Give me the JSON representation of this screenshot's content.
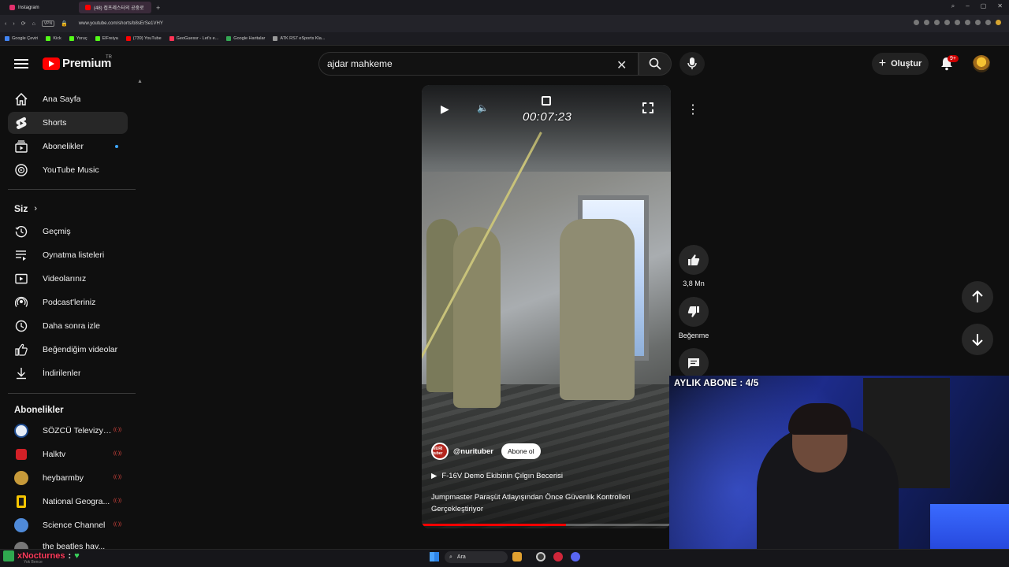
{
  "browser": {
    "tabs": [
      {
        "label": "Instagram",
        "color": "#e1306c",
        "active": false
      },
      {
        "label": "(48) 접프레스터의 공중로",
        "color": "#ff0000",
        "active": true
      }
    ],
    "url": "www.youtube.com/shorts/b8sErSe1VHY",
    "vpn_label": "VPN",
    "bookmarks": [
      {
        "label": "Google Çeviri",
        "color": "#4285f4"
      },
      {
        "label": "Kick",
        "color": "#53fc18"
      },
      {
        "label": "Yoruç",
        "color": "#53fc18"
      },
      {
        "label": "ElFreiya",
        "color": "#53fc18"
      },
      {
        "label": "(739) YouTube",
        "color": "#ff0000"
      },
      {
        "label": "GeoGuessr - Let's e...",
        "color": "#ff3355"
      },
      {
        "label": "Google Haritalar",
        "color": "#34a853"
      },
      {
        "label": "ATK RS7 eSports Kla...",
        "color": "#999999"
      }
    ]
  },
  "header": {
    "logo_text": "Premium",
    "country_code": "TR",
    "search_value": "ajdar mahkeme",
    "create_label": "Oluştur",
    "notification_count": "9+"
  },
  "sidebar": {
    "primary": [
      {
        "label": "Ana Sayfa",
        "icon": "home-icon"
      },
      {
        "label": "Shorts",
        "icon": "shorts-icon",
        "active": true
      },
      {
        "label": "Abonelikler",
        "icon": "subscriptions-icon",
        "dot": true
      },
      {
        "label": "YouTube Music",
        "icon": "music-icon"
      }
    ],
    "you_heading": "Siz",
    "you_items": [
      {
        "label": "Geçmiş",
        "icon": "history-icon"
      },
      {
        "label": "Oynatma listeleri",
        "icon": "playlists-icon"
      },
      {
        "label": "Videolarınız",
        "icon": "your-videos-icon"
      },
      {
        "label": "Podcast'leriniz",
        "icon": "podcasts-icon"
      },
      {
        "label": "Daha sonra izle",
        "icon": "watch-later-icon"
      },
      {
        "label": "Beğendiğim videolar",
        "icon": "liked-icon"
      },
      {
        "label": "İndirilenler",
        "icon": "downloads-icon"
      }
    ],
    "subs_heading": "Abonelikler",
    "subscriptions": [
      {
        "label": "SÖZCÜ Televizyo...",
        "color": "#e8eef7",
        "live": "((·))"
      },
      {
        "label": "Halktv",
        "color": "#d32027",
        "live": "((·))"
      },
      {
        "label": "heybarmby",
        "color": "#c79a3a",
        "live": "((·))"
      },
      {
        "label": "National Geogra...",
        "color": "#f6c500",
        "live": "((·))"
      },
      {
        "label": "Science Channel",
        "color": "#4f8ad9",
        "live": "((·))"
      },
      {
        "label": "the beatles hay...",
        "color": "#777777",
        "live": "((·))"
      }
    ]
  },
  "video": {
    "overlay_time": "00:07:23",
    "channel_handle": "@nurituber",
    "channel_avatar_text": "NURI tuber",
    "subscribe_label": "Abone ol",
    "linked_video": "F-16V Demo Ekibinin Çılgın Becerisi",
    "title": "Jumpmaster Paraşüt Atlayışından Önce Güvenlik Kontrolleri Gerçekleştiriyor",
    "progress": 0.58
  },
  "actions": {
    "like_count": "3,8 Mn",
    "dislike_label": "Beğenme"
  },
  "stream": {
    "overlay_label": "AYLIK ABONE : 4/5",
    "user_name": "xNocturnes",
    "user_separator": ":",
    "user_sub": "Yok Bence"
  },
  "taskbar": {
    "search_label": "Ara"
  }
}
